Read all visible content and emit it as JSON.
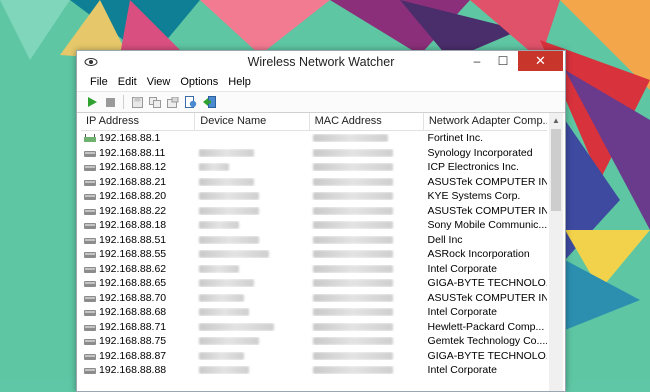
{
  "window": {
    "title": "Wireless Network Watcher",
    "minimize": "–",
    "maximize": "☐",
    "close": "✕"
  },
  "menu": [
    "File",
    "Edit",
    "View",
    "Options",
    "Help"
  ],
  "columns": [
    "IP Address",
    "Device Name",
    "MAC Address",
    "Network Adapter Comp..."
  ],
  "rows": [
    {
      "ip": "192.168.88.1",
      "vendor": "Fortinet Inc.",
      "router": true
    },
    {
      "ip": "192.168.88.11",
      "vendor": "Synology Incorporated"
    },
    {
      "ip": "192.168.88.12",
      "vendor": "ICP Electronics Inc."
    },
    {
      "ip": "192.168.88.21",
      "vendor": "ASUSTek COMPUTER IN..."
    },
    {
      "ip": "192.168.88.20",
      "vendor": "KYE Systems Corp."
    },
    {
      "ip": "192.168.88.22",
      "vendor": "ASUSTek COMPUTER IN..."
    },
    {
      "ip": "192.168.88.18",
      "vendor": "Sony Mobile Communic..."
    },
    {
      "ip": "192.168.88.51",
      "vendor": "Dell Inc"
    },
    {
      "ip": "192.168.88.55",
      "vendor": "ASRock Incorporation"
    },
    {
      "ip": "192.168.88.62",
      "vendor": "Intel Corporate"
    },
    {
      "ip": "192.168.88.65",
      "vendor": "GIGA-BYTE TECHNOLO..."
    },
    {
      "ip": "192.168.88.70",
      "vendor": "ASUSTek COMPUTER IN..."
    },
    {
      "ip": "192.168.88.68",
      "vendor": "Intel Corporate"
    },
    {
      "ip": "192.168.88.71",
      "vendor": "Hewlett-Packard Comp..."
    },
    {
      "ip": "192.168.88.75",
      "vendor": "Gemtek Technology Co...."
    },
    {
      "ip": "192.168.88.87",
      "vendor": "GIGA-BYTE TECHNOLO..."
    },
    {
      "ip": "192.168.88.88",
      "vendor": "Intel Corporate"
    }
  ],
  "icons": {
    "app": "network-eye-icon",
    "start": "play-icon",
    "stop": "stop-icon",
    "save": "save-icon",
    "copy": "copy-icon",
    "properties": "properties-icon",
    "html_report": "html-report-icon",
    "exit": "exit-icon"
  },
  "colors": {
    "close_button": "#c7352b",
    "start_icon": "#2fa12f"
  }
}
